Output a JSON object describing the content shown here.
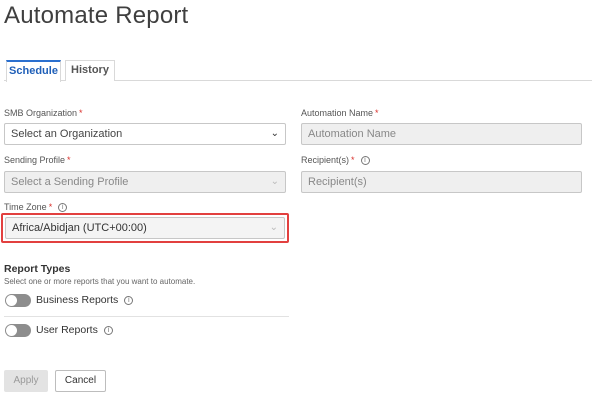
{
  "page": {
    "title": "Automate Report"
  },
  "tabs": [
    {
      "label": "Schedule",
      "active": true
    },
    {
      "label": "History",
      "active": false
    }
  ],
  "form": {
    "smb_org": {
      "label": "SMB Organization",
      "required": "*",
      "value": "Select an Organization",
      "icon": "chevron-down-icon"
    },
    "automation_name": {
      "label": "Automation Name",
      "required": "*",
      "placeholder": "Automation Name"
    },
    "sending_profile": {
      "label": "Sending Profile",
      "required": "*",
      "value": "Select a Sending Profile",
      "icon": "chevron-down-icon"
    },
    "recipients": {
      "label": "Recipient(s)",
      "required": "*",
      "placeholder": "Recipient(s)",
      "info_icon": "ⓘ"
    },
    "time_zone": {
      "label": "Time Zone",
      "required": "*",
      "value": "Africa/Abidjan (UTC+00:00)",
      "info_icon": "ⓘ",
      "icon": "chevron-down-icon"
    }
  },
  "report_types": {
    "title": "Report Types",
    "subtitle": "Select one or more reports that you want to automate.",
    "items": [
      {
        "label": "Business Reports",
        "enabled": false,
        "info_icon": "ⓘ"
      },
      {
        "label": "User Reports",
        "enabled": false,
        "info_icon": "ⓘ"
      }
    ]
  },
  "actions": {
    "apply_label": "Apply",
    "cancel_label": "Cancel"
  },
  "colors": {
    "accent": "#2a6fcf",
    "required": "#d9302b",
    "highlight": "#e2403f",
    "toggle_off": "#8d8d8d"
  }
}
